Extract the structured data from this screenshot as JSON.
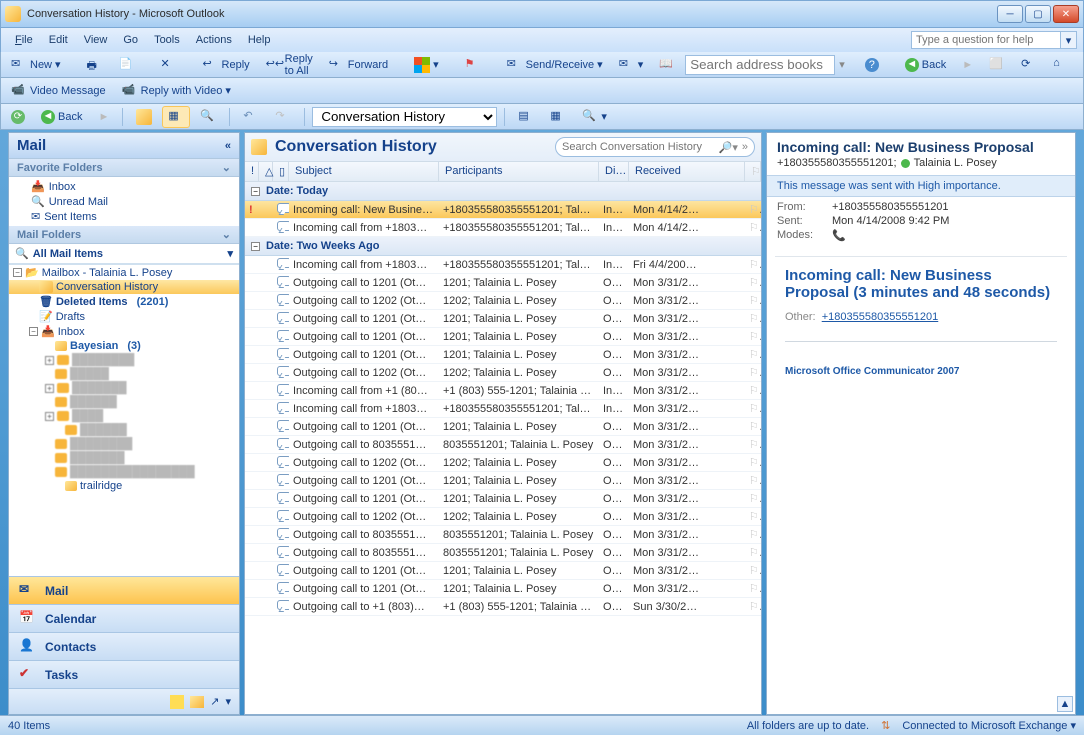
{
  "window": {
    "title": "Conversation History - Microsoft Outlook"
  },
  "menu": {
    "file": "File",
    "edit": "Edit",
    "view": "View",
    "go": "Go",
    "tools": "Tools",
    "actions": "Actions",
    "help": "Help",
    "help_placeholder": "Type a question for help"
  },
  "toolbar1": {
    "new": "New",
    "reply": "Reply",
    "reply_all": "Reply to All",
    "forward": "Forward",
    "send_receive": "Send/Receive",
    "search_books": "Search address books",
    "back": "Back"
  },
  "toolbar2": {
    "video_msg": "Video Message",
    "reply_video": "Reply with Video"
  },
  "toolbar3": {
    "back": "Back",
    "crumb": "Conversation History"
  },
  "nav": {
    "title": "Mail",
    "fav": "Favorite Folders",
    "fav_items": [
      "Inbox",
      "Unread Mail",
      "Sent Items"
    ],
    "mailfolders": "Mail Folders",
    "all": "All Mail Items",
    "mailbox": "Mailbox - Talainia L. Posey",
    "conv": "Conversation History",
    "deleted": "Deleted Items",
    "deleted_count": "(2201)",
    "drafts": "Drafts",
    "inbox": "Inbox",
    "bayesian": "Bayesian",
    "bayesian_count": "(3)",
    "trailridge": "trailridge",
    "mail_btn": "Mail",
    "calendar_btn": "Calendar",
    "contacts_btn": "Contacts",
    "tasks_btn": "Tasks"
  },
  "list": {
    "title": "Conversation History",
    "search_placeholder": "Search Conversation History",
    "cols": {
      "subject": "Subject",
      "participants": "Participants",
      "di": "Di…",
      "received": "Received"
    },
    "group_today": "Date: Today",
    "group_two": "Date: Two Weeks Ago",
    "rows": [
      {
        "grp": "today",
        "sel": true,
        "important": true,
        "subj": "Incoming call: New Busine…",
        "part": "+180355580355551201; Talaini…",
        "di": "In…",
        "recv": "Mon 4/14/2…"
      },
      {
        "grp": "today",
        "subj": "Incoming call from +1803…",
        "part": "+180355580355551201; Talaini…",
        "di": "In…",
        "recv": "Mon 4/14/2…"
      },
      {
        "grp": "two",
        "subj": "Incoming call from +1803…",
        "part": "+180355580355551201; Talaini…",
        "di": "In…",
        "recv": "Fri 4/4/200…"
      },
      {
        "grp": "two",
        "subj": "Outgoing call to 1201 (Ot…",
        "part": "1201; Talainia L. Posey",
        "di": "O…",
        "recv": "Mon 3/31/2…"
      },
      {
        "grp": "two",
        "subj": "Outgoing call to 1202 (Ot…",
        "part": "1202; Talainia L. Posey",
        "di": "O…",
        "recv": "Mon 3/31/2…"
      },
      {
        "grp": "two",
        "subj": "Outgoing call to 1201 (Ot…",
        "part": "1201; Talainia L. Posey",
        "di": "O…",
        "recv": "Mon 3/31/2…"
      },
      {
        "grp": "two",
        "subj": "Outgoing call to 1201 (Ot…",
        "part": "1201; Talainia L. Posey",
        "di": "O…",
        "recv": "Mon 3/31/2…"
      },
      {
        "grp": "two",
        "subj": "Outgoing call to 1201 (Ot…",
        "part": "1201; Talainia L. Posey",
        "di": "O…",
        "recv": "Mon 3/31/2…"
      },
      {
        "grp": "two",
        "subj": "Outgoing call to 1202 (Ot…",
        "part": "1202; Talainia L. Posey",
        "di": "O…",
        "recv": "Mon 3/31/2…"
      },
      {
        "grp": "two",
        "subj": "Incoming call from +1 (80…",
        "part": "+1 (803) 555-1201; Talainia L…",
        "di": "In…",
        "recv": "Mon 3/31/2…"
      },
      {
        "grp": "two",
        "subj": "Incoming call from +1803…",
        "part": "+180355580355551201; Talaini…",
        "di": "In…",
        "recv": "Mon 3/31/2…"
      },
      {
        "grp": "two",
        "subj": "Outgoing call to 1201 (Ot…",
        "part": "1201; Talainia L. Posey",
        "di": "O…",
        "recv": "Mon 3/31/2…"
      },
      {
        "grp": "two",
        "subj": "Outgoing call to 8035551…",
        "part": "8035551201; Talainia L. Posey",
        "di": "O…",
        "recv": "Mon 3/31/2…"
      },
      {
        "grp": "two",
        "subj": "Outgoing call to 1202 (Ot…",
        "part": "1202; Talainia L. Posey",
        "di": "O…",
        "recv": "Mon 3/31/2…"
      },
      {
        "grp": "two",
        "subj": "Outgoing call to 1201 (Ot…",
        "part": "1201; Talainia L. Posey",
        "di": "O…",
        "recv": "Mon 3/31/2…"
      },
      {
        "grp": "two",
        "subj": "Outgoing call to 1201 (Ot…",
        "part": "1201; Talainia L. Posey",
        "di": "O…",
        "recv": "Mon 3/31/2…"
      },
      {
        "grp": "two",
        "subj": "Outgoing call to 1202 (Ot…",
        "part": "1202; Talainia L. Posey",
        "di": "O…",
        "recv": "Mon 3/31/2…"
      },
      {
        "grp": "two",
        "subj": "Outgoing call to 8035551…",
        "part": "8035551201; Talainia L. Posey",
        "di": "O…",
        "recv": "Mon 3/31/2…"
      },
      {
        "grp": "two",
        "subj": "Outgoing call to 8035551…",
        "part": "8035551201; Talainia L. Posey",
        "di": "O…",
        "recv": "Mon 3/31/2…"
      },
      {
        "grp": "two",
        "subj": "Outgoing call to 1201 (Ot…",
        "part": "1201; Talainia L. Posey",
        "di": "O…",
        "recv": "Mon 3/31/2…"
      },
      {
        "grp": "two",
        "subj": "Outgoing call to 1201 (Ot…",
        "part": "1201; Talainia L. Posey",
        "di": "O…",
        "recv": "Mon 3/31/2…"
      },
      {
        "grp": "two",
        "subj": "Outgoing call to +1 (803)…",
        "part": "+1 (803) 555-1201; Talainia L…",
        "di": "O…",
        "recv": "Sun 3/30/2…"
      }
    ]
  },
  "reading": {
    "subject": "Incoming call: New Business Proposal",
    "from_line": "+180355580355551201;",
    "presence_name": "Talainia L. Posey",
    "infobar": "This message was sent with High importance.",
    "from_lbl": "From:",
    "from_val": "+180355580355551201",
    "sent_lbl": "Sent:",
    "sent_val": "Mon 4/14/2008 9:42 PM",
    "modes_lbl": "Modes:",
    "body_title": "Incoming call: New Business Proposal (3 minutes and 48 seconds)",
    "other_lbl": "Other:",
    "other_link": "+180355580355551201",
    "signature": "Microsoft Office Communicator 2007"
  },
  "status": {
    "items": "40 Items",
    "sync": "All folders are up to date.",
    "conn": "Connected to Microsoft Exchange"
  }
}
